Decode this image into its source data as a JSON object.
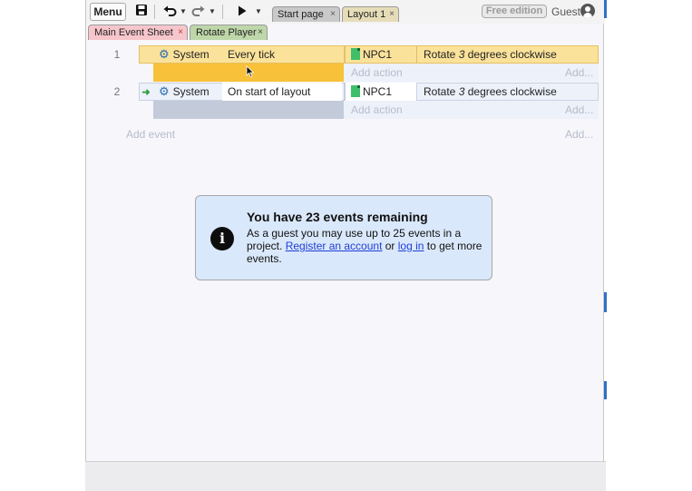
{
  "toolbar": {
    "menu_label": "Menu",
    "save_icon": "save-icon",
    "undo_icon": "undo-icon",
    "redo_icon": "redo-icon",
    "play_icon": "play-icon",
    "tabs": [
      {
        "label": "Start page",
        "close": "×"
      },
      {
        "label": "Layout 1",
        "close": "×"
      }
    ],
    "edition_badge": "Free edition",
    "user_label": "Guest",
    "user_icon": "user-avatar-icon"
  },
  "sheet_tabs": [
    {
      "label": "Main Event Sheet",
      "close": "×",
      "color": "#f7c6cc"
    },
    {
      "label": "Rotate Player",
      "close": "×",
      "color": "#bed7a9"
    }
  ],
  "events": [
    {
      "number": "1",
      "condition_object": "System",
      "condition_text": "Every tick",
      "action_object": "NPC1",
      "action_text_pre": "Rotate ",
      "action_text_em": "3",
      "action_text_post": " degrees clockwise",
      "add_action": "Add action",
      "add_more": "Add...",
      "selected": true
    },
    {
      "number": "2",
      "condition_object": "System",
      "condition_text": "On start of layout",
      "action_object": "NPC1",
      "action_text_pre": "Rotate ",
      "action_text_em": "3",
      "action_text_post": " degrees clockwise",
      "add_action": "Add action",
      "add_more": "Add...",
      "selected": false
    }
  ],
  "add_event": "Add event",
  "add_event_more": "Add...",
  "notice": {
    "title": "You have 23 events remaining",
    "body_1": "As a guest you may use up to 25 events in a project. ",
    "link_register": "Register an account",
    "body_2": " or ",
    "link_login": "log in",
    "body_3": " to get more events."
  },
  "colors": {
    "selected_row": "#fbe29a",
    "selected_band": "#f8c13a",
    "unselected_band": "#c3cbdb",
    "event_bg": "#edf1fa",
    "info_bg": "#dae8fb"
  }
}
